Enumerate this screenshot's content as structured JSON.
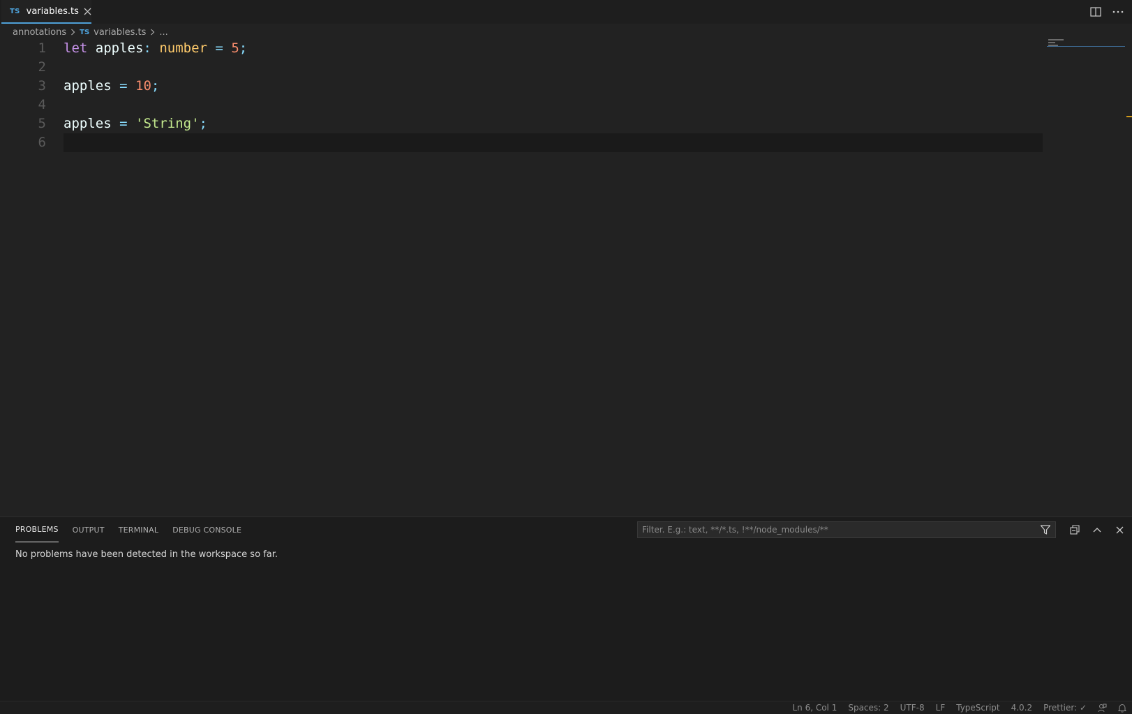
{
  "tabs": [
    {
      "badge": "TS",
      "label": "variables.ts",
      "close_glyph": "✕"
    }
  ],
  "breadcrumb": {
    "folder": "annotations",
    "file_badge": "TS",
    "file": "variables.ts",
    "more": "..."
  },
  "editor": {
    "line_numbers": [
      "1",
      "2",
      "3",
      "4",
      "5",
      "6"
    ],
    "lines": [
      [
        {
          "t": "let",
          "c": "kw"
        },
        {
          "t": " apples",
          "c": "id"
        },
        {
          "t": ":",
          "c": "punct"
        },
        {
          "t": " ",
          "c": "id"
        },
        {
          "t": "number",
          "c": "type"
        },
        {
          "t": " ",
          "c": "id"
        },
        {
          "t": "=",
          "c": "op"
        },
        {
          "t": " ",
          "c": "id"
        },
        {
          "t": "5",
          "c": "num"
        },
        {
          "t": ";",
          "c": "punct"
        }
      ],
      [],
      [
        {
          "t": "apples",
          "c": "id"
        },
        {
          "t": " ",
          "c": "id"
        },
        {
          "t": "=",
          "c": "op"
        },
        {
          "t": " ",
          "c": "id"
        },
        {
          "t": "10",
          "c": "num"
        },
        {
          "t": ";",
          "c": "punct"
        }
      ],
      [],
      [
        {
          "t": "apples",
          "c": "id"
        },
        {
          "t": " ",
          "c": "id"
        },
        {
          "t": "=",
          "c": "op"
        },
        {
          "t": " ",
          "c": "id"
        },
        {
          "t": "'String'",
          "c": "str"
        },
        {
          "t": ";",
          "c": "punct"
        }
      ],
      []
    ]
  },
  "panel": {
    "tabs": [
      "PROBLEMS",
      "OUTPUT",
      "TERMINAL",
      "DEBUG CONSOLE"
    ],
    "active_tab": "PROBLEMS",
    "filter_placeholder": "Filter. E.g.: text, **/*.ts, !**/node_modules/**",
    "message": "No problems have been detected in the workspace so far."
  },
  "statusbar": {
    "position": "Ln 6, Col 1",
    "spaces": "Spaces: 2",
    "encoding": "UTF-8",
    "eol": "LF",
    "language": "TypeScript",
    "ts_version": "4.0.2",
    "prettier": "Prettier: ✓"
  },
  "colors": {
    "accent": "#4fa0d8",
    "keyword": "#c792ea",
    "type": "#ffcb6b",
    "number": "#f78c6c",
    "string": "#c3e88d",
    "operator": "#89ddff"
  }
}
